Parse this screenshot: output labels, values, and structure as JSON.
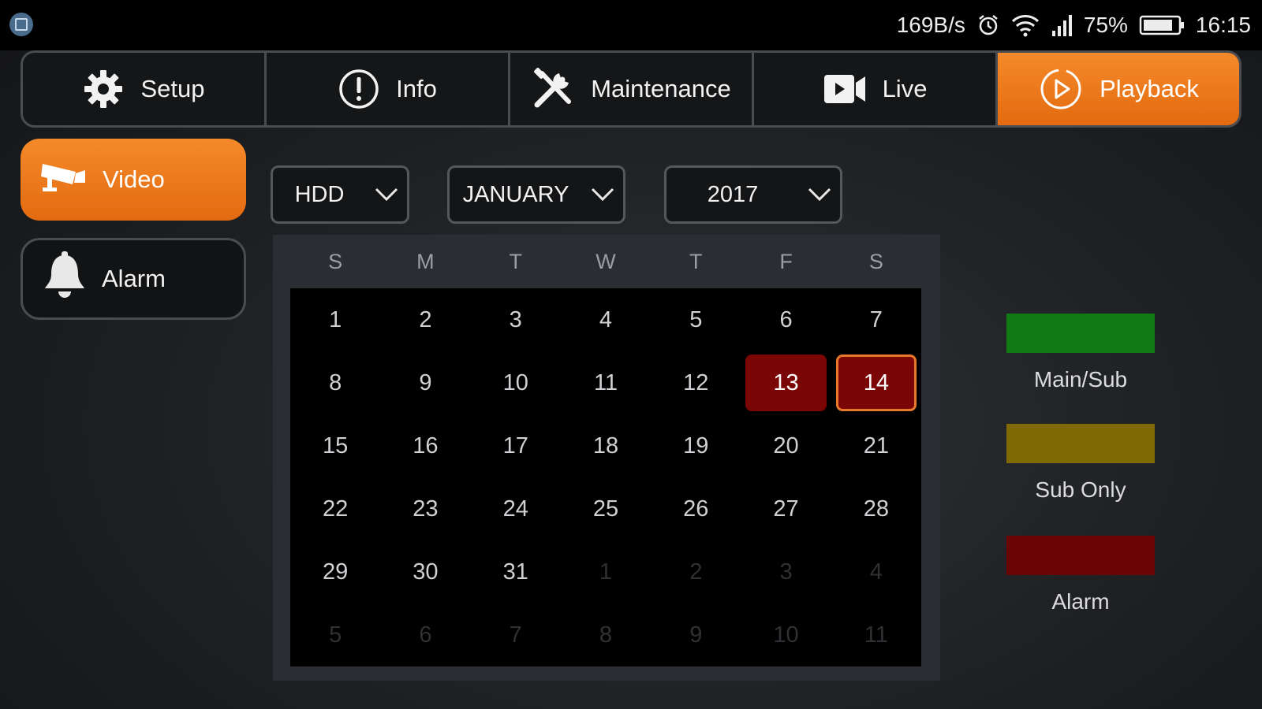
{
  "status_bar": {
    "net_speed": "169B/s",
    "battery": "75%",
    "time": "16:15"
  },
  "top_nav": {
    "tabs": [
      {
        "label": "Setup",
        "icon": "gear-icon"
      },
      {
        "label": "Info",
        "icon": "info-icon"
      },
      {
        "label": "Maintenance",
        "icon": "tools-icon"
      },
      {
        "label": "Live",
        "icon": "video-camera-icon"
      },
      {
        "label": "Playback",
        "icon": "play-circle-icon",
        "active": true
      }
    ]
  },
  "side_nav": {
    "video_label": "Video",
    "alarm_label": "Alarm"
  },
  "filters": {
    "storage": "HDD",
    "month": "JANUARY",
    "year": "2017"
  },
  "calendar": {
    "weekdays": [
      "S",
      "M",
      "T",
      "W",
      "T",
      "F",
      "S"
    ],
    "days": [
      {
        "d": "1"
      },
      {
        "d": "2"
      },
      {
        "d": "3"
      },
      {
        "d": "4"
      },
      {
        "d": "5"
      },
      {
        "d": "6"
      },
      {
        "d": "7"
      },
      {
        "d": "8"
      },
      {
        "d": "9"
      },
      {
        "d": "10"
      },
      {
        "d": "11"
      },
      {
        "d": "12"
      },
      {
        "d": "13",
        "mark": "alarm"
      },
      {
        "d": "14",
        "mark": "alarm",
        "selected": true
      },
      {
        "d": "15"
      },
      {
        "d": "16"
      },
      {
        "d": "17"
      },
      {
        "d": "18"
      },
      {
        "d": "19"
      },
      {
        "d": "20"
      },
      {
        "d": "21"
      },
      {
        "d": "22"
      },
      {
        "d": "23"
      },
      {
        "d": "24"
      },
      {
        "d": "25"
      },
      {
        "d": "26"
      },
      {
        "d": "27"
      },
      {
        "d": "28"
      },
      {
        "d": "29"
      },
      {
        "d": "30"
      },
      {
        "d": "31"
      },
      {
        "d": "1",
        "other": true
      },
      {
        "d": "2",
        "other": true
      },
      {
        "d": "3",
        "other": true
      },
      {
        "d": "4",
        "other": true
      },
      {
        "d": "5",
        "other": true
      },
      {
        "d": "6",
        "other": true
      },
      {
        "d": "7",
        "other": true
      },
      {
        "d": "8",
        "other": true
      },
      {
        "d": "9",
        "other": true
      },
      {
        "d": "10",
        "other": true
      },
      {
        "d": "11",
        "other": true
      }
    ]
  },
  "legend": {
    "items": [
      {
        "label": "Main/Sub",
        "color": "#137a13"
      },
      {
        "label": "Sub Only",
        "color": "#7f6a06"
      },
      {
        "label": "Alarm",
        "color": "#6a0606"
      }
    ]
  },
  "colors": {
    "accent": "#ef7a1a",
    "alarm_day": "#7a0606"
  }
}
